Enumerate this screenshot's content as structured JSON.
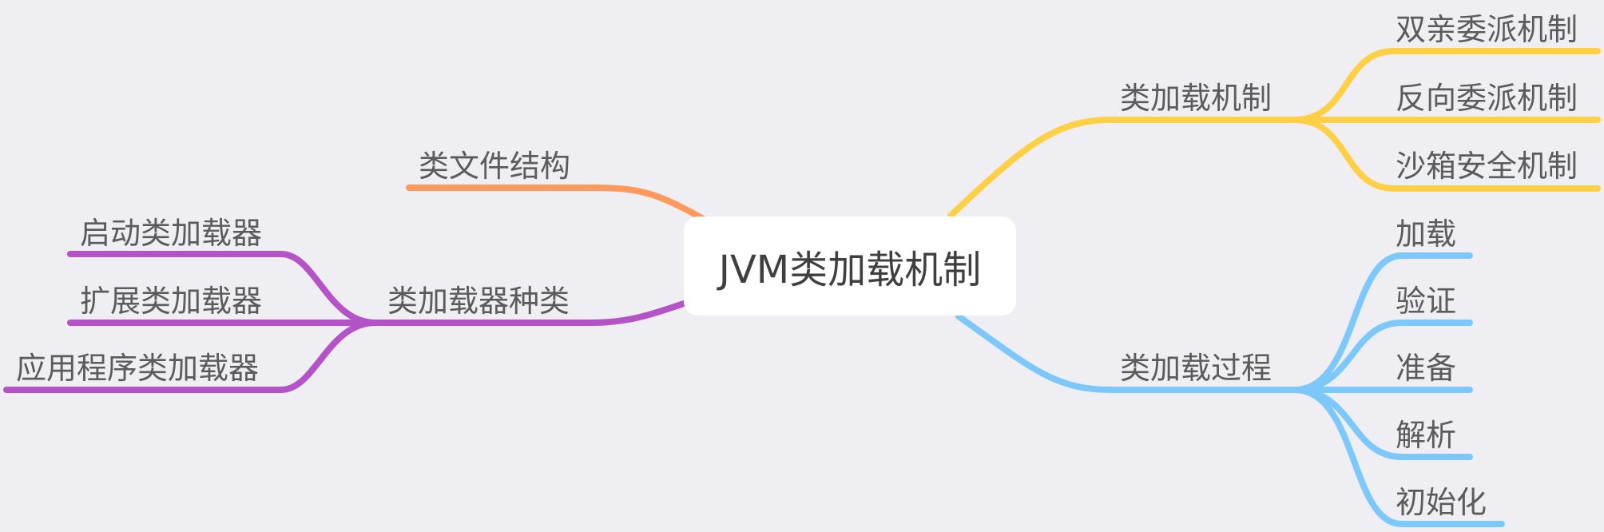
{
  "root": {
    "label": "JVM类加载机制"
  },
  "colors": {
    "background": "#efeef3",
    "class_file": "#ff9a5c",
    "loader_types": "#b452c7",
    "load_mechanism": "#ffcf45",
    "load_process": "#7cc8fb"
  },
  "branches": {
    "class_file": {
      "label": "类文件结构"
    },
    "loader_types": {
      "label": "类加载器种类",
      "children": [
        "启动类加载器",
        "扩展类加载器",
        "应用程序类加载器"
      ]
    },
    "load_mechanism": {
      "label": "类加载机制",
      "children": [
        "双亲委派机制",
        "反向委派机制",
        "沙箱安全机制"
      ]
    },
    "load_process": {
      "label": "类加载过程",
      "children": [
        "加载",
        "验证",
        "准备",
        "解析",
        "初始化"
      ]
    }
  }
}
